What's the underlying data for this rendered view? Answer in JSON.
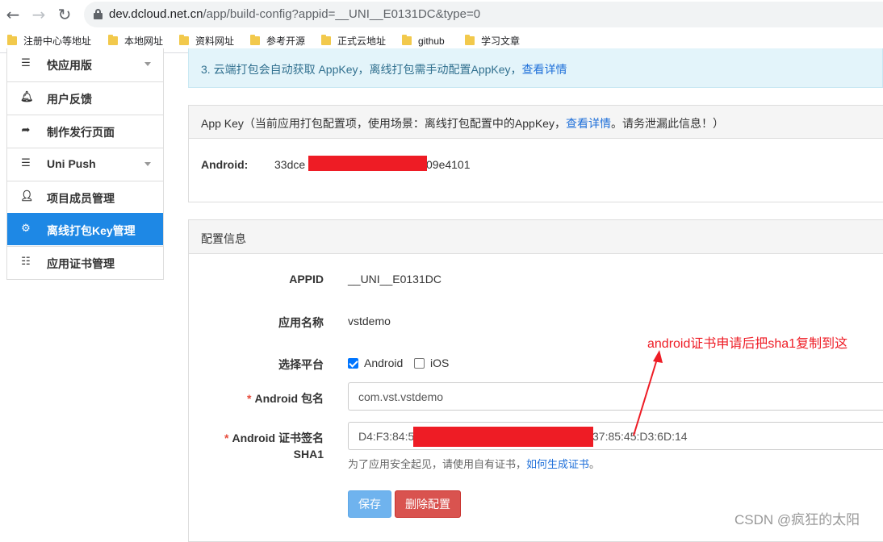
{
  "browser": {
    "url_host": "dev.dcloud.net.cn",
    "url_path": "/app/build-config?appid=__UNI__E0131DC&type=0",
    "bookmarks": [
      "注册中心等地址",
      "本地网址",
      "资料网址",
      "参考开源",
      "正式云地址",
      "github",
      "学习文章"
    ]
  },
  "sidebar": {
    "items": [
      {
        "label": "快应用版",
        "icon": "menu-icon"
      },
      {
        "label": "用户反馈",
        "icon": "bell-icon"
      },
      {
        "label": "制作发行页面",
        "icon": "share-icon"
      },
      {
        "label": "Uni Push",
        "icon": "menu-icon"
      },
      {
        "label": "项目成员管理",
        "icon": "user-icon"
      },
      {
        "label": "离线打包Key管理",
        "icon": "gear-icon"
      },
      {
        "label": "应用证书管理",
        "icon": "list-icon"
      }
    ],
    "active": "离线打包Key管理"
  },
  "alert": {
    "line3": "3. 云端打包会自动获取 AppKey，离线打包需手动配置AppKey，",
    "line3_link": "查看详情"
  },
  "appkey_panel": {
    "title_prefix": "App Key（当前应用打包配置项，使用场景：离线打包配置中的AppKey，",
    "title_link": "查看详情",
    "title_suffix": "。请务泄漏此信息！）",
    "android_label": "Android:",
    "key_start": "33dce",
    "key_end": "09e4101"
  },
  "config_panel": {
    "title": "配置信息",
    "appid_label": "APPID",
    "appid_value": "__UNI__E0131DC",
    "appname_label": "应用名称",
    "appname_value": "vstdemo",
    "platform_label": "选择平台",
    "platform_android": "Android",
    "platform_android_checked": true,
    "platform_ios": "iOS",
    "platform_ios_checked": false,
    "package_label": "Android 包名",
    "package_value": "com.vst.vstdemo",
    "sha1_label_line1": "Android 证书签名",
    "sha1_label_line2": "SHA1",
    "sha1_start": "D4:F3:84:5",
    "sha1_end": "37:85:45:D3:6D:14",
    "help_text": "为了应用安全起见，请使用自有证书，",
    "help_link": "如何生成证书",
    "help_end": "。",
    "save_button": "保存",
    "delete_button": "删除配置"
  },
  "annotation": "android证书申请后把sha1复制到这",
  "watermark": "CSDN @疯狂的太阳",
  "colors": {
    "accent": "#1e88e5",
    "redaction": "#ee1c25",
    "danger": "#d9534f"
  }
}
